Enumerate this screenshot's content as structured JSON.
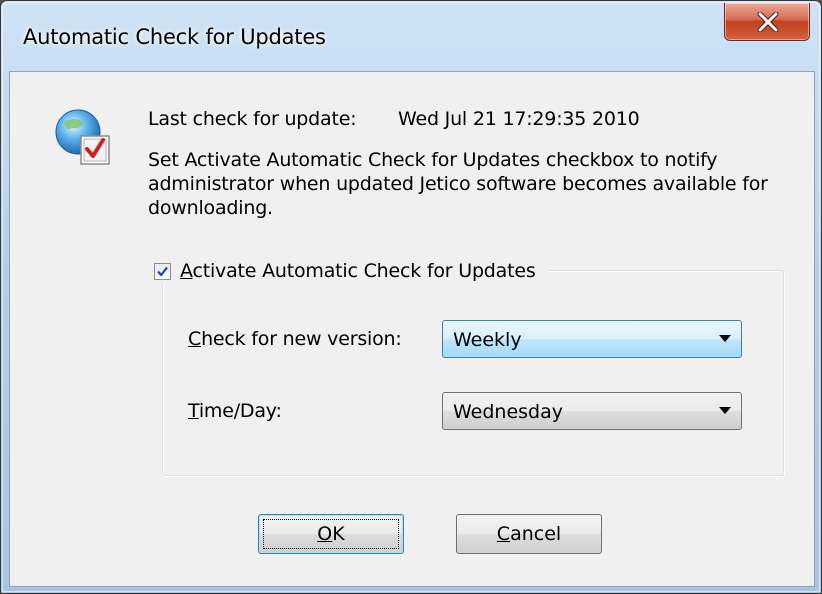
{
  "window": {
    "title": "Automatic Check for Updates",
    "close_icon": "close-x-icon",
    "app_icon": "globe-checkmark-icon"
  },
  "info": {
    "last_check_label": "Last check for update:",
    "last_check_value": "Wed Jul 21 17:29:35 2010",
    "description": "Set Activate Automatic Check for Updates checkbox to notify administrator when updated Jetico software becomes available for downloading."
  },
  "group": {
    "checkbox_checked": true,
    "checkbox_accel": "A",
    "checkbox_label_rest": "ctivate Automatic Check for Updates"
  },
  "fields": {
    "version_accel": "C",
    "version_label_rest": "heck for new version:",
    "version_value": "Weekly",
    "time_accel": "T",
    "time_label_rest": "ime/Day:",
    "time_value": "Wednesday"
  },
  "buttons": {
    "ok_accel": "O",
    "ok_rest": "K",
    "cancel_accel": "C",
    "cancel_rest": "ancel"
  },
  "colors": {
    "close_button": "#c7432a",
    "title_bar": "#b3cfe8",
    "client_bg": "#f0f0f0",
    "focus_blue": "#3c7fb1"
  }
}
